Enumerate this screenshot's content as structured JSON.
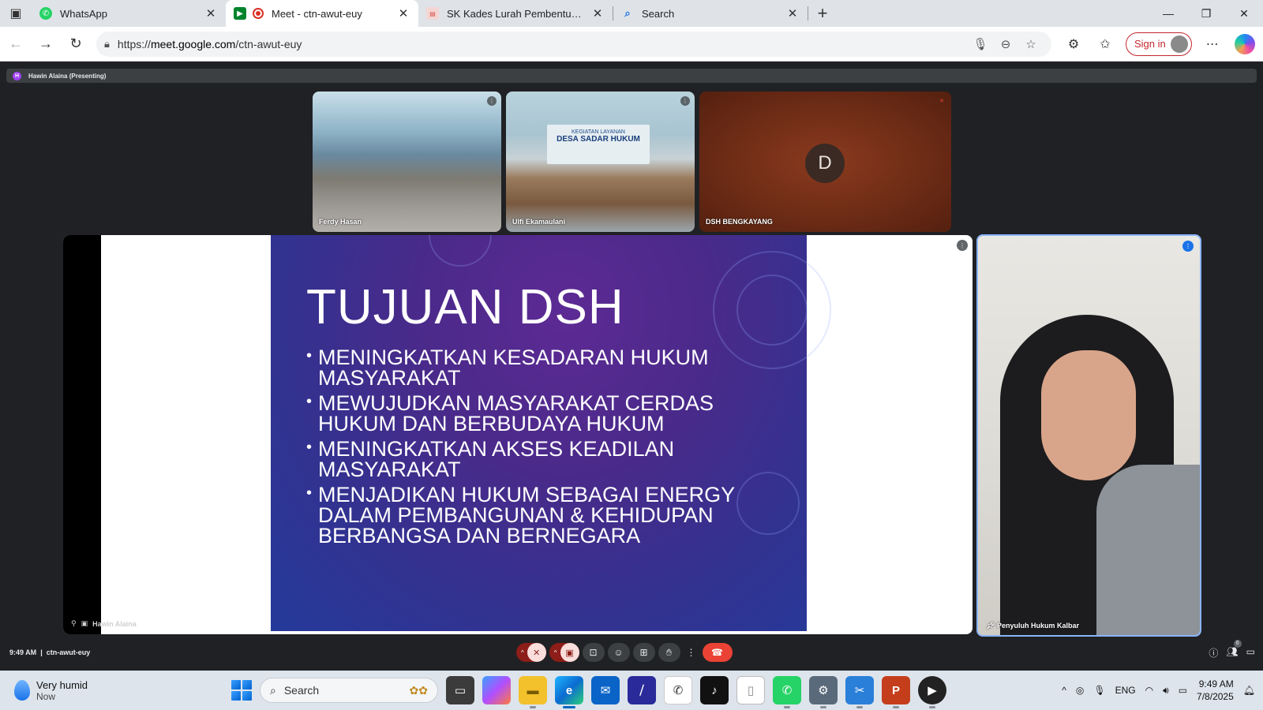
{
  "browser": {
    "tabs": [
      {
        "title": "WhatsApp",
        "icon": "whatsapp-icon",
        "color": "#25d366"
      },
      {
        "title": "Meet - ctn-awut-euy",
        "icon": "meet-icon",
        "color": "#00832d",
        "recording": true
      },
      {
        "title": "SK Kades Lurah Pembentukan Pos",
        "icon": "pdf-icon",
        "color": "#d9534f"
      },
      {
        "title": "Search",
        "icon": "search-icon",
        "color": "#1a73e8"
      }
    ],
    "url_prefix": "https://",
    "url_host": "meet.google.com",
    "url_path": "/ctn-awut-euy",
    "sign_in_label": "Sign in"
  },
  "meet": {
    "presenter_label": "Hawin Alaina (Presenting)",
    "presenter_initial": "H",
    "thumbnails": [
      {
        "name": "Ferdy Hasan"
      },
      {
        "name": "Ulfi Ekamaulani"
      },
      {
        "name": "DSH BENGKAYANG",
        "initial": "D"
      }
    ],
    "room_banner": {
      "line1": "KEGIATAN LAYANAN",
      "line2": "DESA SADAR HUKUM"
    },
    "stage_name": "Hawin Alaina",
    "slide": {
      "title": "TUJUAN DSH",
      "bullets": [
        "MENINGKATKAN KESADARAN HUKUM MASYARAKAT",
        "MEWUJUDKAN MASYARAKAT CERDAS HUKUM DAN BERBUDAYA HUKUM",
        "MENINGKATKAN AKSES KEADILAN MASYARAKAT",
        "MENJADIKAN HUKUM SEBAGAI ENERGY DALAM PEMBANGUNAN & KEHIDUPAN BERBANGSA DAN BERNEGARA"
      ]
    },
    "speaker_name": "Penyuluh Hukum Kalbar",
    "time": "9:49 AM",
    "meeting_code": "ctn-awut-euy",
    "participant_count": "6"
  },
  "taskbar": {
    "weather_title": "Very humid",
    "weather_sub": "Now",
    "search_placeholder": "Search",
    "lang": "ENG",
    "clock_time": "9:49 AM",
    "clock_date": "7/8/2025"
  }
}
